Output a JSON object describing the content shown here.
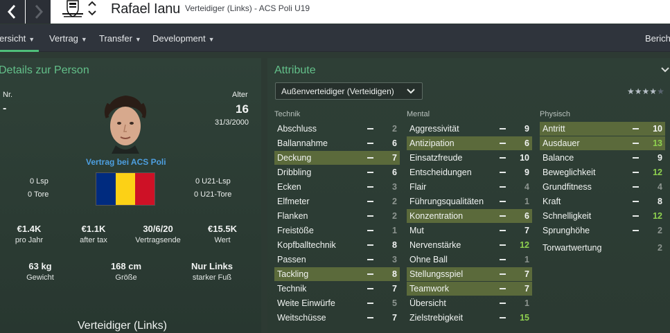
{
  "header": {
    "player_name": "Rafael Ianu",
    "subtitle": "Verteidiger (Links) - ACS Poli U19"
  },
  "tabs": [
    {
      "label": "Übersicht",
      "display": "ersicht",
      "active": true
    },
    {
      "label": "Vertrag"
    },
    {
      "label": "Transfer"
    },
    {
      "label": "Development"
    },
    {
      "label": "Berich"
    }
  ],
  "details": {
    "title": "Details zur Person",
    "nr_label": "Nr.",
    "nr_value": "-",
    "age_label": "Alter",
    "age_value": "16",
    "dob": "31/3/2000",
    "contract_link": "Vertrag bei ACS Poli",
    "lsp": "0 Lsp",
    "tore": "0 Tore",
    "u21_lsp": "0 U21-Lsp",
    "u21_tore": "0 U21-Tore",
    "finance": [
      {
        "value": "€1.4K",
        "label": "pro Jahr"
      },
      {
        "value": "€1.1K",
        "label": "after tax"
      },
      {
        "value": "30/6/20",
        "label": "Vertragsende"
      },
      {
        "value": "€15.5K",
        "label": "Wert"
      }
    ],
    "physical": [
      {
        "value": "63 kg",
        "label": "Gewicht"
      },
      {
        "value": "168 cm",
        "label": "Größe"
      },
      {
        "value": "Nur Links",
        "label": "starker Fuß"
      }
    ],
    "position": "Verteidiger (Links)",
    "flag_colors": [
      "#002b7f",
      "#fcd116",
      "#ce1126"
    ]
  },
  "attributes": {
    "title": "Attribute",
    "role_select": "Außenverteidiger (Verteidigen)",
    "stars_rating": 4,
    "stars_total": 5,
    "technik": {
      "header": "Technik",
      "items": [
        {
          "name": "Abschluss",
          "value": "2",
          "hl": false
        },
        {
          "name": "Ballannahme",
          "value": "6",
          "hl": false
        },
        {
          "name": "Deckung",
          "value": "7",
          "hl": true
        },
        {
          "name": "Dribbling",
          "value": "6",
          "hl": false
        },
        {
          "name": "Ecken",
          "value": "3",
          "hl": false
        },
        {
          "name": "Elfmeter",
          "value": "2",
          "hl": false
        },
        {
          "name": "Flanken",
          "value": "2",
          "hl": false
        },
        {
          "name": "Freistöße",
          "value": "1",
          "hl": false
        },
        {
          "name": "Kopfballtechnik",
          "value": "8",
          "hl": false
        },
        {
          "name": "Passen",
          "value": "3",
          "hl": false
        },
        {
          "name": "Tackling",
          "value": "8",
          "hl": true
        },
        {
          "name": "Technik",
          "value": "7",
          "hl": false
        },
        {
          "name": "Weite Einwürfe",
          "value": "5",
          "hl": false
        },
        {
          "name": "Weitschüsse",
          "value": "7",
          "hl": false
        }
      ]
    },
    "mental": {
      "header": "Mental",
      "items": [
        {
          "name": "Aggressivität",
          "value": "9",
          "hl": false
        },
        {
          "name": "Antizipation",
          "value": "6",
          "hl": true
        },
        {
          "name": "Einsatzfreude",
          "value": "10",
          "hl": false
        },
        {
          "name": "Entscheidungen",
          "value": "9",
          "hl": false
        },
        {
          "name": "Flair",
          "value": "4",
          "hl": false
        },
        {
          "name": "Führungsqualitäten",
          "value": "1",
          "hl": false
        },
        {
          "name": "Konzentration",
          "value": "6",
          "hl": true
        },
        {
          "name": "Mut",
          "value": "7",
          "hl": false
        },
        {
          "name": "Nervenstärke",
          "value": "12",
          "hl": false
        },
        {
          "name": "Ohne Ball",
          "value": "1",
          "hl": false
        },
        {
          "name": "Stellungsspiel",
          "value": "7",
          "hl": true
        },
        {
          "name": "Teamwork",
          "value": "7",
          "hl": true
        },
        {
          "name": "Übersicht",
          "value": "1",
          "hl": false
        },
        {
          "name": "Zielstrebigkeit",
          "value": "15",
          "hl": false
        }
      ]
    },
    "physisch": {
      "header": "Physisch",
      "items": [
        {
          "name": "Antritt",
          "value": "10",
          "hl": true
        },
        {
          "name": "Ausdauer",
          "value": "13",
          "hl": true
        },
        {
          "name": "Balance",
          "value": "9",
          "hl": false
        },
        {
          "name": "Beweglichkeit",
          "value": "12",
          "hl": false
        },
        {
          "name": "Grundfitness",
          "value": "4",
          "hl": false
        },
        {
          "name": "Kraft",
          "value": "8",
          "hl": false
        },
        {
          "name": "Schnelligkeit",
          "value": "12",
          "hl": false
        },
        {
          "name": "Sprunghöhe",
          "value": "2",
          "hl": false
        }
      ]
    },
    "gk_rating": {
      "name": "Torwartwertung",
      "value": "2"
    }
  },
  "colors": {
    "accent_green": "#4fbf7a",
    "highlight_row": "#5b6a3b",
    "high_value": "#8fd14f",
    "low_value": "#8d9590"
  }
}
